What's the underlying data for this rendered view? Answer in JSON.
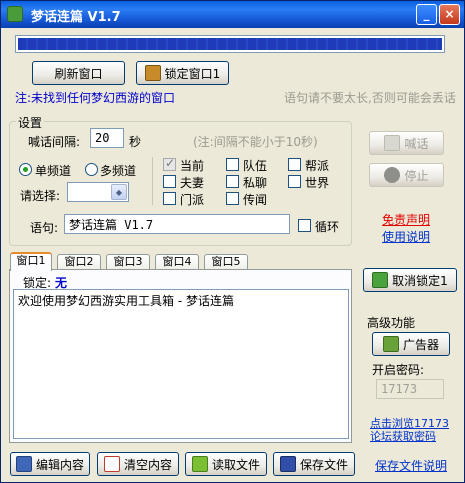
{
  "window": {
    "title": "梦话连篇 V1.7",
    "progress_percent": 100,
    "minimize_glyph": "_",
    "close_glyph": "×"
  },
  "toolbar": {
    "refresh_label": "刷新窗口",
    "lock_label": "锁定窗口1"
  },
  "status": {
    "not_found": "注:未找到任何梦幻西游的窗口",
    "hint": "语句请不要太长,否则可能会丢话"
  },
  "settings": {
    "legend": "设置",
    "interval_label": "喊话间隔:",
    "interval_value": "20",
    "interval_unit": "秒",
    "interval_note": "(注:间隔不能小于10秒)",
    "single_channel": "单频道",
    "multi_channel": "多频道",
    "choose_label": "请选择:",
    "channels": [
      {
        "label": "当前",
        "checked": true
      },
      {
        "label": "队伍",
        "checked": false
      },
      {
        "label": "帮派",
        "checked": false
      },
      {
        "label": "夫妻",
        "checked": false
      },
      {
        "label": "私聊",
        "checked": false
      },
      {
        "label": "世界",
        "checked": false
      },
      {
        "label": "门派",
        "checked": false
      },
      {
        "label": "传闻",
        "checked": false
      }
    ],
    "sentence_label": "语句:",
    "sentence_value": "梦话连篇 V1.7",
    "loop_label": "循环"
  },
  "side": {
    "shout_label": "喊话",
    "stop_label": "停止",
    "disclaimer": "免责声明",
    "instructions": "使用说明",
    "unlock_label": "取消锁定1",
    "advanced_title": "高级功能",
    "ad_label": "广告器",
    "password_label": "开启密码:",
    "password_value": "17173",
    "forum_line1": "点击浏览17173",
    "forum_line2": "论坛获取密码",
    "save_help": "保存文件说明"
  },
  "tabs": [
    "窗口1",
    "窗口2",
    "窗口3",
    "窗口4",
    "窗口5"
  ],
  "panel": {
    "locked_label": "锁定:",
    "locked_value": "无",
    "content": "欢迎使用梦幻西游实用工具箱 - 梦话连篇"
  },
  "bottom": {
    "edit_label": "编辑内容",
    "clear_label": "清空内容",
    "read_label": "读取文件",
    "save_label": "保存文件"
  }
}
